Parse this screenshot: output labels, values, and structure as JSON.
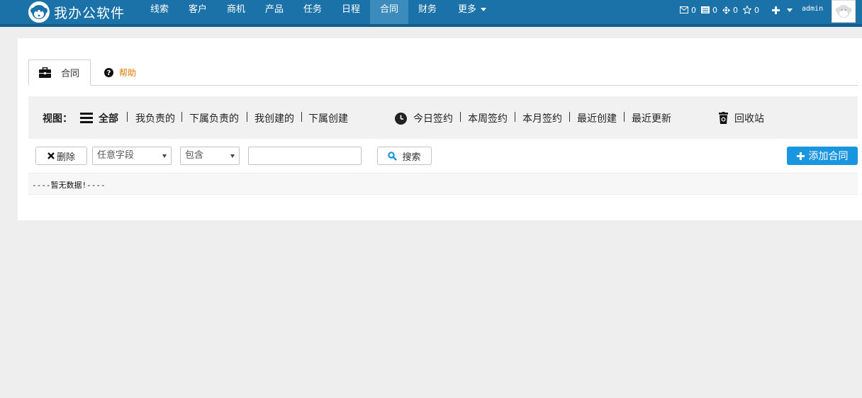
{
  "app": {
    "brand": "我办公软件"
  },
  "nav": {
    "items": [
      "线索",
      "客户",
      "商机",
      "产品",
      "任务",
      "日程",
      "合同",
      "财务",
      "更多"
    ],
    "active": "合同",
    "counters": {
      "mail": "0",
      "messages": "0",
      "tasks": "0",
      "favorites": "0"
    },
    "user": "admin"
  },
  "tabs": {
    "active_label": "合同",
    "help_label": "帮助"
  },
  "filters": {
    "view_label": "视图：",
    "scope_items": [
      "全部",
      "我负责的",
      "下属负责的",
      "我创建的",
      "下属创建"
    ],
    "time_items": [
      "今日签约",
      "本周签约",
      "本月签约",
      "最近创建",
      "最近更新"
    ],
    "recycle_label": "回收站"
  },
  "toolbar": {
    "delete_label": "删除",
    "field_select": "任意字段",
    "condition_select": "包含",
    "search_value": "",
    "search_label": "搜索",
    "add_label": "添加合同"
  },
  "table": {
    "empty_message": "----暂无数据!----"
  },
  "colors": {
    "navbar": "#1b72a8",
    "nav_active": "#3b8bbd",
    "primary": "#1a95e0",
    "help": "#e07b00",
    "page_bg": "#eeeeee"
  }
}
